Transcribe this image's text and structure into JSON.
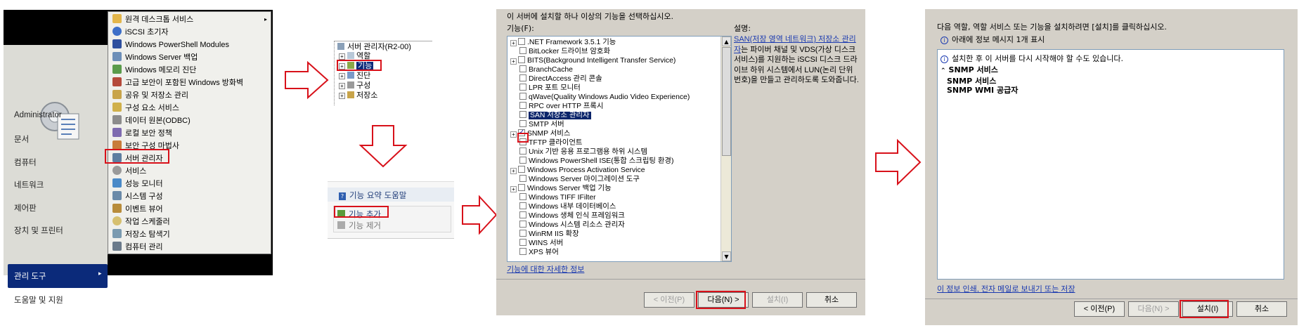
{
  "start_menu": {
    "user": "Administrator",
    "left_items": [
      "문서",
      "컴퓨터",
      "네트워크",
      "제어판",
      "장치 및 프린터",
      "관리 도구",
      "도움말 및 지원"
    ],
    "selected": "관리 도구",
    "admin_tools": [
      "원격 데스크톱 서비스",
      "iSCSI 초기자",
      "Windows PowerShell Modules",
      "Windows Server 백업",
      "Windows 메모리 진단",
      "고급 보안이 포함된 Windows 방화벽",
      "공유 및 저장소 관리",
      "구성 요소 서비스",
      "데이터 원본(ODBC)",
      "로컬 보안 정책",
      "보안 구성 마법사",
      "서버 관리자",
      "서비스",
      "성능 모니터",
      "시스템 구성",
      "이벤트 뷰어",
      "작업 스케줄러",
      "저장소 탐색기",
      "컴퓨터 관리"
    ],
    "highlighted_tool": "서버 관리자"
  },
  "tree": {
    "root": "서버 관리자(R2-00)",
    "nodes": [
      "역할",
      "기능",
      "진단",
      "구성",
      "저장소"
    ],
    "highlighted": "기능"
  },
  "actions": {
    "header": "기능 요약 도움말",
    "add": "기능 추가",
    "remove": "기능 제거"
  },
  "features_dialog": {
    "instruction": "이 서버에 설치할 하나 이상의 기능을 선택하십시오.",
    "list_label": "기능(F):",
    "desc_label": "설명:",
    "desc_link": "SAN(저장 영역 네트워크) 저장소 관리자",
    "desc_text": "는 파이버 채널 및 VDS(가상 디스크 서비스)를 지원하는 iSCSI 디스크 드라이브 하위 시스템에서 LUN(논리 단위 번호)을 만들고 관리하도록 도와줍니다.",
    "features": [
      ".NET Framework 3.5.1 기능",
      "BitLocker 드라이브 암호화",
      "BITS(Background Intelligent Transfer Service)",
      "BranchCache",
      "DirectAccess 관리 콘솔",
      "LPR 포트 모니터",
      "qWave(Quality Windows Audio Video Experience)",
      "RPC over HTTP 프록시",
      "SAN 저장소 관리자",
      "SMTP 서버",
      "SNMP 서비스",
      "TFTP 클라이언트",
      "Unix 기반 응용 프로그램용 하위 시스템",
      "Windows PowerShell ISE(통합 스크립팅 환경)",
      "Windows Process Activation Service",
      "Windows Server 마이그레이션 도구",
      "Windows Server 백업 기능",
      "Windows TIFF IFilter",
      "Windows 내부 데이터베이스",
      "Windows 생체 인식 프레임워크",
      "Windows 시스템 리소스 관리자",
      "WinRM IIS 확장",
      "WINS 서버",
      "XPS 뷰어"
    ],
    "selected_feature": "SAN 저장소 관리자",
    "checked_feature": "SNMP 서비스",
    "more_link": "기능에 대한 자세한 정보",
    "buttons": {
      "prev": "< 이전(P)",
      "next": "다음(N) >",
      "install": "설치(I)",
      "cancel": "취소"
    }
  },
  "confirm_dialog": {
    "instruction": "다음 역할, 역할 서비스 또는 기능을 설치하려면 [설치]를 클릭하십시오.",
    "info_count": "아래에 정보 메시지 1개 표시",
    "restart_note": "설치한 후 이 서버를 다시 시작해야 할 수도 있습니다.",
    "section": "SNMP 서비스",
    "items": [
      "SNMP 서비스",
      "SNMP WMI 공급자"
    ],
    "print_link": "이 정보 인쇄, 전자 메일로 보내기 또는 저장",
    "buttons": {
      "prev": "< 이전(P)",
      "next": "다음(N) >",
      "install": "설치(I)",
      "cancel": "취소"
    }
  },
  "colors": {
    "highlight_red": "#d8111a",
    "menu_selected": "#0b2a7a",
    "dialog_bg": "#d4d0c8",
    "link": "#1c3bb0"
  }
}
